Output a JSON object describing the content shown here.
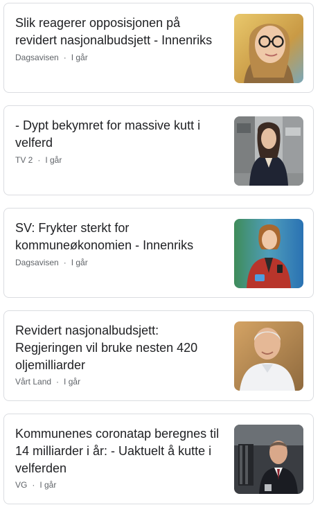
{
  "articles": [
    {
      "headline": "Slik reagerer opposisjonen på revidert nasjonalbudsjett - Innenriks",
      "source": "Dagsavisen",
      "separator": "·",
      "time": "I går",
      "thumbnail": "politician-woman-glasses-photo"
    },
    {
      "headline": "- Dypt bekymret for massive kutt i velferd",
      "source": "TV 2",
      "separator": "·",
      "time": "I går",
      "thumbnail": "politician-woman-street-photo"
    },
    {
      "headline": "SV: Frykter sterkt for kommuneøkonomien - Innenriks",
      "source": "Dagsavisen",
      "separator": "·",
      "time": "I går",
      "thumbnail": "politician-woman-red-jacket-photo"
    },
    {
      "headline": "Revidert nasjonalbudsjett: Regjeringen vil bruke nesten 420 oljemilliarder",
      "source": "Vårt Land",
      "separator": "·",
      "time": "I går",
      "thumbnail": "politician-man-white-shirt-photo"
    },
    {
      "headline": "Kommunenes coronatap beregnes til 14 milliarder i år: - Uaktuelt å kutte i velferden",
      "source": "VG",
      "separator": "·",
      "time": "I går",
      "thumbnail": "politician-man-suit-photo"
    }
  ]
}
